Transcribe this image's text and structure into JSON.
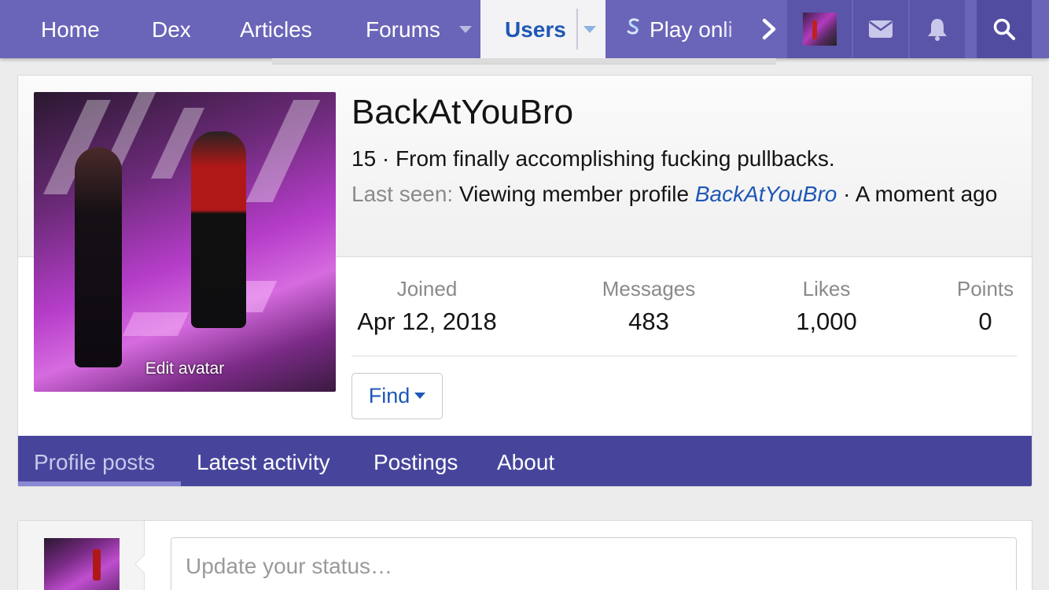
{
  "nav": {
    "items": [
      {
        "label": "Home"
      },
      {
        "label": "Dex"
      },
      {
        "label": "Articles"
      },
      {
        "label": "Forums"
      },
      {
        "label": "Users"
      },
      {
        "label": "Play onli"
      }
    ],
    "icons": [
      "user-avatar-icon",
      "mail-icon",
      "bell-icon",
      "search-icon"
    ],
    "colors": {
      "bar": "#6a65b8",
      "active_bg": "#f3f3f5",
      "active_text": "#1e57b5"
    }
  },
  "profile": {
    "username": "BackAtYouBro",
    "blurb": "15 · From finally accomplishing fucking pullbacks.",
    "last_seen_label": "Last seen:",
    "last_seen_activity": "Viewing member profile",
    "last_seen_link": "BackAtYouBro",
    "last_seen_time": "· A moment ago",
    "edit_avatar": "Edit avatar",
    "stats": [
      {
        "label": "Joined",
        "value": "Apr 12, 2018"
      },
      {
        "label": "Messages",
        "value": "483"
      },
      {
        "label": "Likes",
        "value": "1,000"
      },
      {
        "label": "Points",
        "value": "0"
      }
    ],
    "find_label": "Find"
  },
  "tabs": [
    {
      "label": "Profile posts",
      "active": true
    },
    {
      "label": "Latest activity"
    },
    {
      "label": "Postings"
    },
    {
      "label": "About"
    }
  ],
  "status": {
    "placeholder": "Update your status…"
  },
  "colors": {
    "tab_bar": "#47459b",
    "link": "#1e57b5"
  }
}
